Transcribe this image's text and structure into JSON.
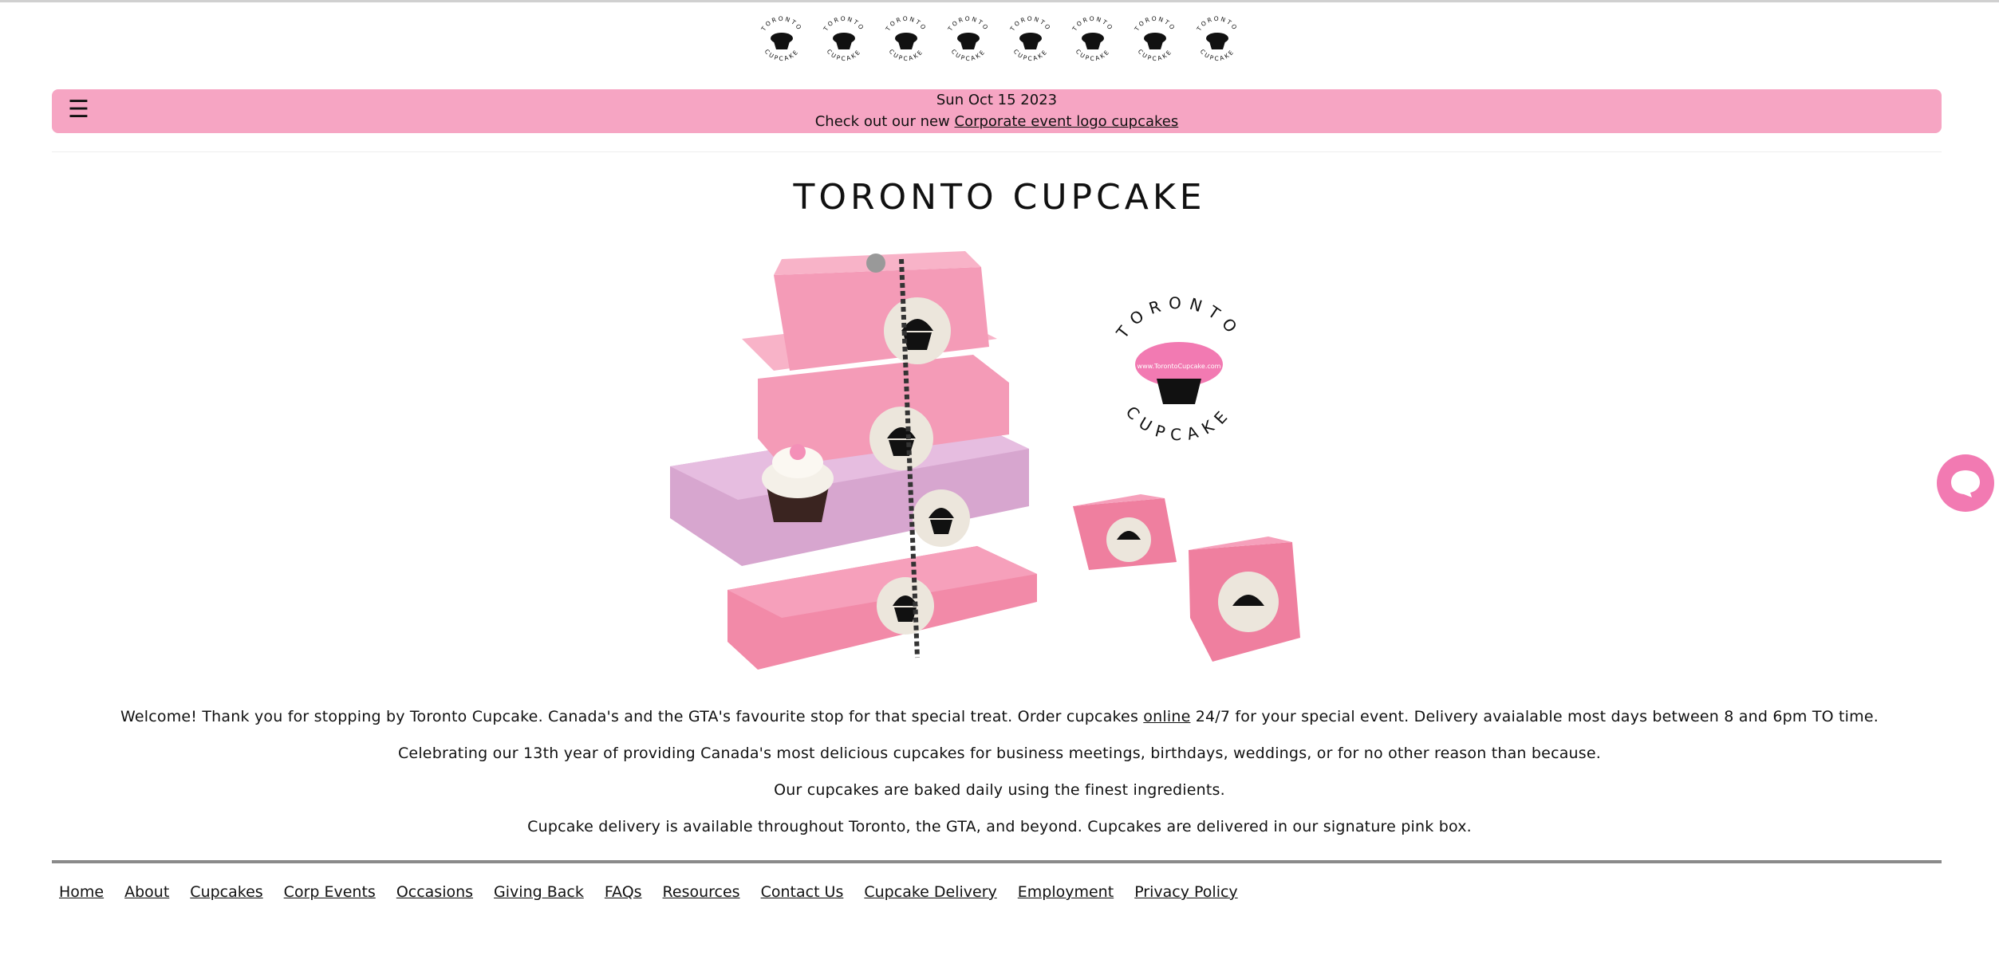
{
  "logo": {
    "text_top": "TORONTO",
    "text_bottom": "CUPCAKE",
    "repeat_count": 8
  },
  "banner": {
    "date": "Sun Oct 15 2023",
    "announcement_prefix": "Check out our new ",
    "announcement_link": "Corporate event logo cupcakes",
    "menu_icon": "☰"
  },
  "page": {
    "title": "TORONTO CUPCAKE"
  },
  "hero": {
    "logo_text_top": "TORONTO",
    "logo_text_bottom": "CUPCAKE",
    "logo_url_text": "www.TorontoCupcake.com"
  },
  "content": {
    "para1_before": "Welcome! Thank you for stopping by Toronto Cupcake. Canada's and the GTA's favourite stop for that special treat. Order cupcakes ",
    "para1_link": "online",
    "para1_after": " 24/7 for your special event. Delivery avaialable most days between 8 and 6pm TO time.",
    "para2": "Celebrating our 13th year of providing Canada's most delicious cupcakes for business meetings, birthdays, weddings, or for no other reason than because.",
    "para3": "Our cupcakes are baked daily using the finest ingredients.",
    "para4": "Cupcake delivery is available throughout Toronto, the GTA, and beyond. Cupcakes are delivered in our signature pink box."
  },
  "footer": {
    "links": [
      "Home",
      "About",
      "Cupcakes",
      "Corp Events",
      "Occasions",
      "Giving Back",
      "FAQs",
      "Resources",
      "Contact Us",
      "Cupcake Delivery",
      "Employment",
      "Privacy Policy"
    ]
  },
  "colors": {
    "banner_bg": "#f6a5c3",
    "chat_button": "#f27ab2",
    "box_pink": "#f28aa8",
    "box_lavender": "#d7a6cf"
  },
  "icons": {
    "menu": "hamburger-icon",
    "chat": "chat-bubble-icon"
  }
}
